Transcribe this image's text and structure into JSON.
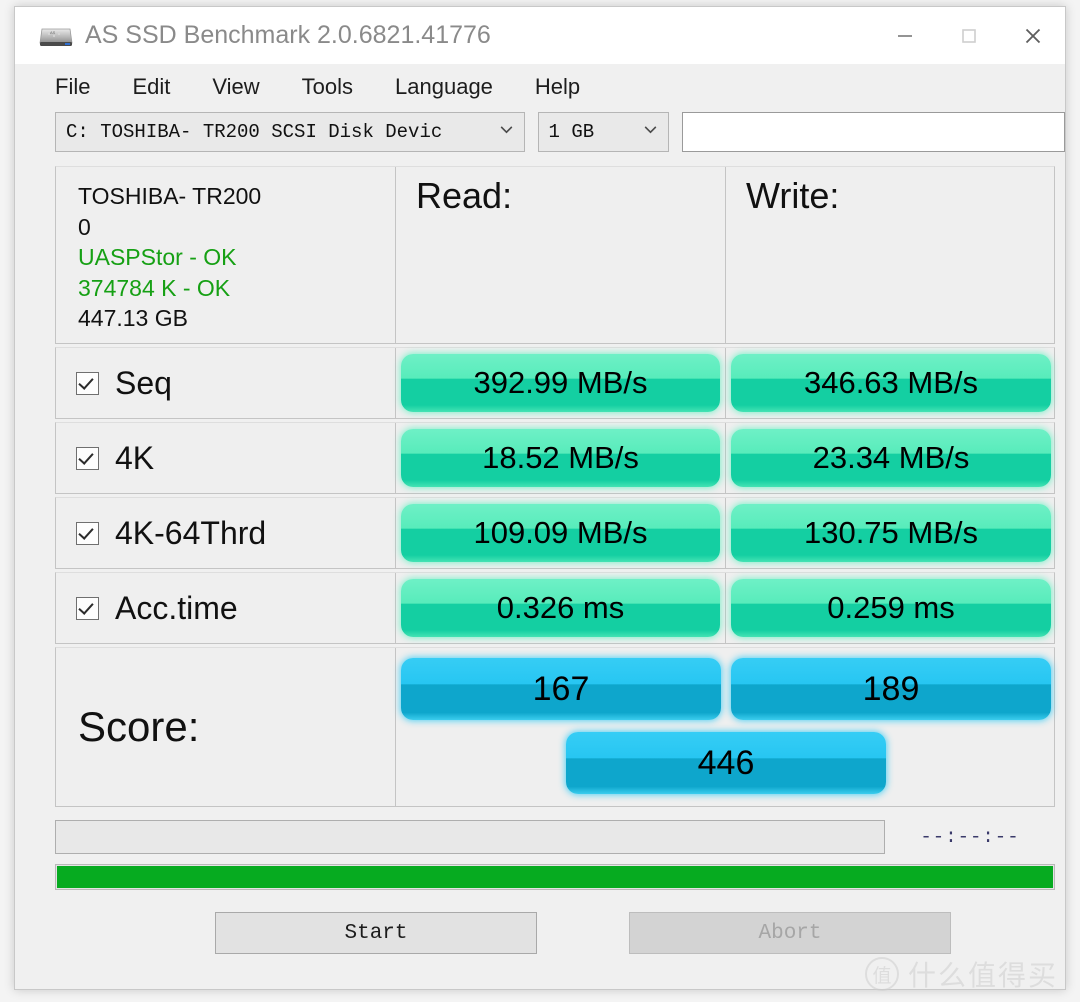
{
  "window": {
    "title": "AS SSD Benchmark 2.0.6821.41776",
    "icon": "ssd-drive-icon",
    "minimize_label": "—",
    "maximize_label": "□",
    "close_label": "✕"
  },
  "menu": {
    "items": [
      {
        "label": "File"
      },
      {
        "label": "Edit"
      },
      {
        "label": "View"
      },
      {
        "label": "Tools"
      },
      {
        "label": "Language"
      },
      {
        "label": "Help"
      }
    ]
  },
  "toolbar": {
    "drive_select": {
      "value": "C: TOSHIBA- TR200 SCSI Disk Devic",
      "arrow": "⌄"
    },
    "size_select": {
      "value": "1 GB",
      "arrow": "⌄"
    },
    "info_textbox": {
      "value": "",
      "placeholder": ""
    }
  },
  "drive_info": {
    "model": "TOSHIBA- TR200",
    "firmware": "0",
    "driver_status": "UASPStor - OK",
    "alignment_status": "374784 K - OK",
    "capacity": "447.13 GB"
  },
  "columns": {
    "read_header": "Read:",
    "write_header": "Write:"
  },
  "chart_data": {
    "type": "bar",
    "title": "AS SSD Benchmark results",
    "categories": [
      "Seq",
      "4K",
      "4K-64Thrd",
      "Acc.time"
    ],
    "series": [
      {
        "name": "Read:",
        "values": [
          392.99,
          18.52,
          109.09,
          0.326
        ]
      },
      {
        "name": "Write:",
        "values": [
          346.63,
          23.34,
          130.75,
          0.259
        ]
      }
    ],
    "units": [
      "MB/s",
      "MB/s",
      "MB/s",
      "ms"
    ],
    "scores": {
      "read": 167,
      "write": 189,
      "total": 446
    },
    "legend": [
      "Read:",
      "Write:"
    ],
    "accent_green": "#14cfa2",
    "accent_blue": "#0ea6cc"
  },
  "rows": [
    {
      "label": "Seq",
      "checked": true,
      "read": "392.99 MB/s",
      "write": "346.63 MB/s"
    },
    {
      "label": "4K",
      "checked": true,
      "read": "18.52 MB/s",
      "write": "23.34 MB/s"
    },
    {
      "label": "4K-64Thrd",
      "checked": true,
      "read": "109.09 MB/s",
      "write": "130.75 MB/s"
    },
    {
      "label": "Acc.time",
      "checked": true,
      "read": "0.326 ms",
      "write": "0.259 ms"
    }
  ],
  "score": {
    "label": "Score:",
    "read": "167",
    "write": "189",
    "total": "446"
  },
  "status": {
    "message": "",
    "elapsed_time": "--:--:--",
    "progress_percent": 100
  },
  "buttons": {
    "start": "Start",
    "abort": "Abort"
  },
  "watermark": {
    "mark": "值",
    "text": "什么值得买"
  }
}
